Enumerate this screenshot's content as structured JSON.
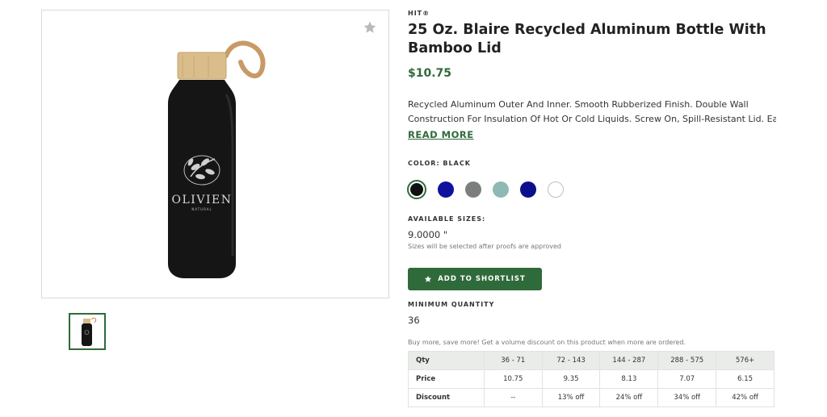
{
  "product": {
    "brand": "HIT®",
    "title": "25 Oz. Blaire Recycled Aluminum Bottle With Bamboo Lid",
    "price": "$10.75",
    "description_lines": [
      "Recycled Aluminum Outer And Inner. Smooth Rubberized Finish. Double Wall",
      "Construction For Insulation Of Hot Or Cold Liquids. Screw On, Spill-Resistant Lid. Ea..."
    ],
    "read_more": "READ MORE",
    "logo_text": "OLIVIEN",
    "logo_subtext": "NATURAL"
  },
  "color": {
    "label": "COLOR: BLACK",
    "swatches": [
      "#111111",
      "#10129e",
      "#7b7e7d",
      "#8fb9b4",
      "#0c0f8c",
      "#ffffff"
    ]
  },
  "sizes": {
    "label": "AVAILABLE SIZES:",
    "value": "9.0000 \"",
    "note": "Sizes will be selected after proofs are approved"
  },
  "actions": {
    "shortlist_label": "ADD TO SHORTLIST"
  },
  "minimum": {
    "label": "MINIMUM QUANTITY",
    "value": "36"
  },
  "pricing": {
    "note": "Buy more, save more! Get a volume discount on this product when more are ordered.",
    "header": [
      "Qty",
      "36 - 71",
      "72 - 143",
      "144 - 287",
      "288 - 575",
      "576+"
    ],
    "price_row": [
      "Price",
      "10.75",
      "9.35",
      "8.13",
      "7.07",
      "6.15"
    ],
    "discount_row": [
      "Discount",
      "--",
      "13% off",
      "24% off",
      "34% off",
      "42% off"
    ]
  },
  "colors": {
    "accent": "#2f6a3a",
    "table_header_bg": "#e9ece9"
  }
}
